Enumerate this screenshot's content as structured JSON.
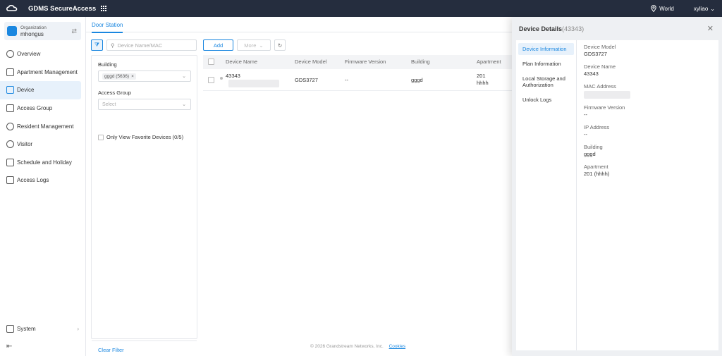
{
  "topbar": {
    "app_title": "GDMS SecureAccess",
    "region": "World",
    "user": "xyliao"
  },
  "sidebar": {
    "org_label": "Organization",
    "org_name": "mhongus",
    "items": [
      {
        "label": "Overview",
        "icon": "pie-chart-icon",
        "active": false
      },
      {
        "label": "Apartment Management",
        "icon": "building-icon",
        "active": false
      },
      {
        "label": "Device",
        "icon": "device-icon",
        "active": true
      },
      {
        "label": "Access Group",
        "icon": "access-group-icon",
        "active": false
      },
      {
        "label": "Resident Management",
        "icon": "person-icon",
        "active": false
      },
      {
        "label": "Visitor",
        "icon": "visitor-icon",
        "active": false
      },
      {
        "label": "Schedule and Holiday",
        "icon": "calendar-icon",
        "active": false
      },
      {
        "label": "Access Logs",
        "icon": "logs-icon",
        "active": false
      }
    ],
    "system_label": "System"
  },
  "main": {
    "tab_label": "Door Station",
    "search_placeholder": "Device Name/MAC",
    "filter": {
      "building_label": "Building",
      "building_chip": "gggd (5636)",
      "access_group_label": "Access Group",
      "access_group_placeholder": "Select",
      "favorite_label": "Only View Favorite Devices (0/5)",
      "clear_label": "Clear Filter"
    },
    "toolbar": {
      "add_label": "Add",
      "more_label": "More"
    },
    "table": {
      "columns": [
        "Device Name",
        "Device Model",
        "Firmware Version",
        "Building",
        "Apartment"
      ],
      "rows": [
        {
          "device_name": "43343",
          "device_model": "GDS3727",
          "firmware": "--",
          "building": "gggd",
          "apartment_no": "201",
          "apartment_name": "hhhh"
        }
      ]
    },
    "footer": {
      "copyright": "© 2026 Grandstream Networks, Inc.",
      "cookies": "Cookies"
    }
  },
  "details": {
    "title": "Device Details",
    "title_id": "(43343)",
    "tabs": [
      "Device Information",
      "Plan Information",
      "Local Storage and Authorization",
      "Unlock Logs"
    ],
    "fields": [
      {
        "label": "Device Model",
        "value": "GDS3727"
      },
      {
        "label": "Device Name",
        "value": "43343"
      },
      {
        "label": "MAC Address",
        "value": ""
      },
      {
        "label": "Firmware Version",
        "value": "--"
      },
      {
        "label": "IP Address",
        "value": "--"
      },
      {
        "label": "Building",
        "value": "gggd"
      },
      {
        "label": "Apartment",
        "value": "201 (hhhh)"
      }
    ]
  },
  "colors": {
    "accent": "#1a87e0",
    "topbar": "#252d3e"
  }
}
